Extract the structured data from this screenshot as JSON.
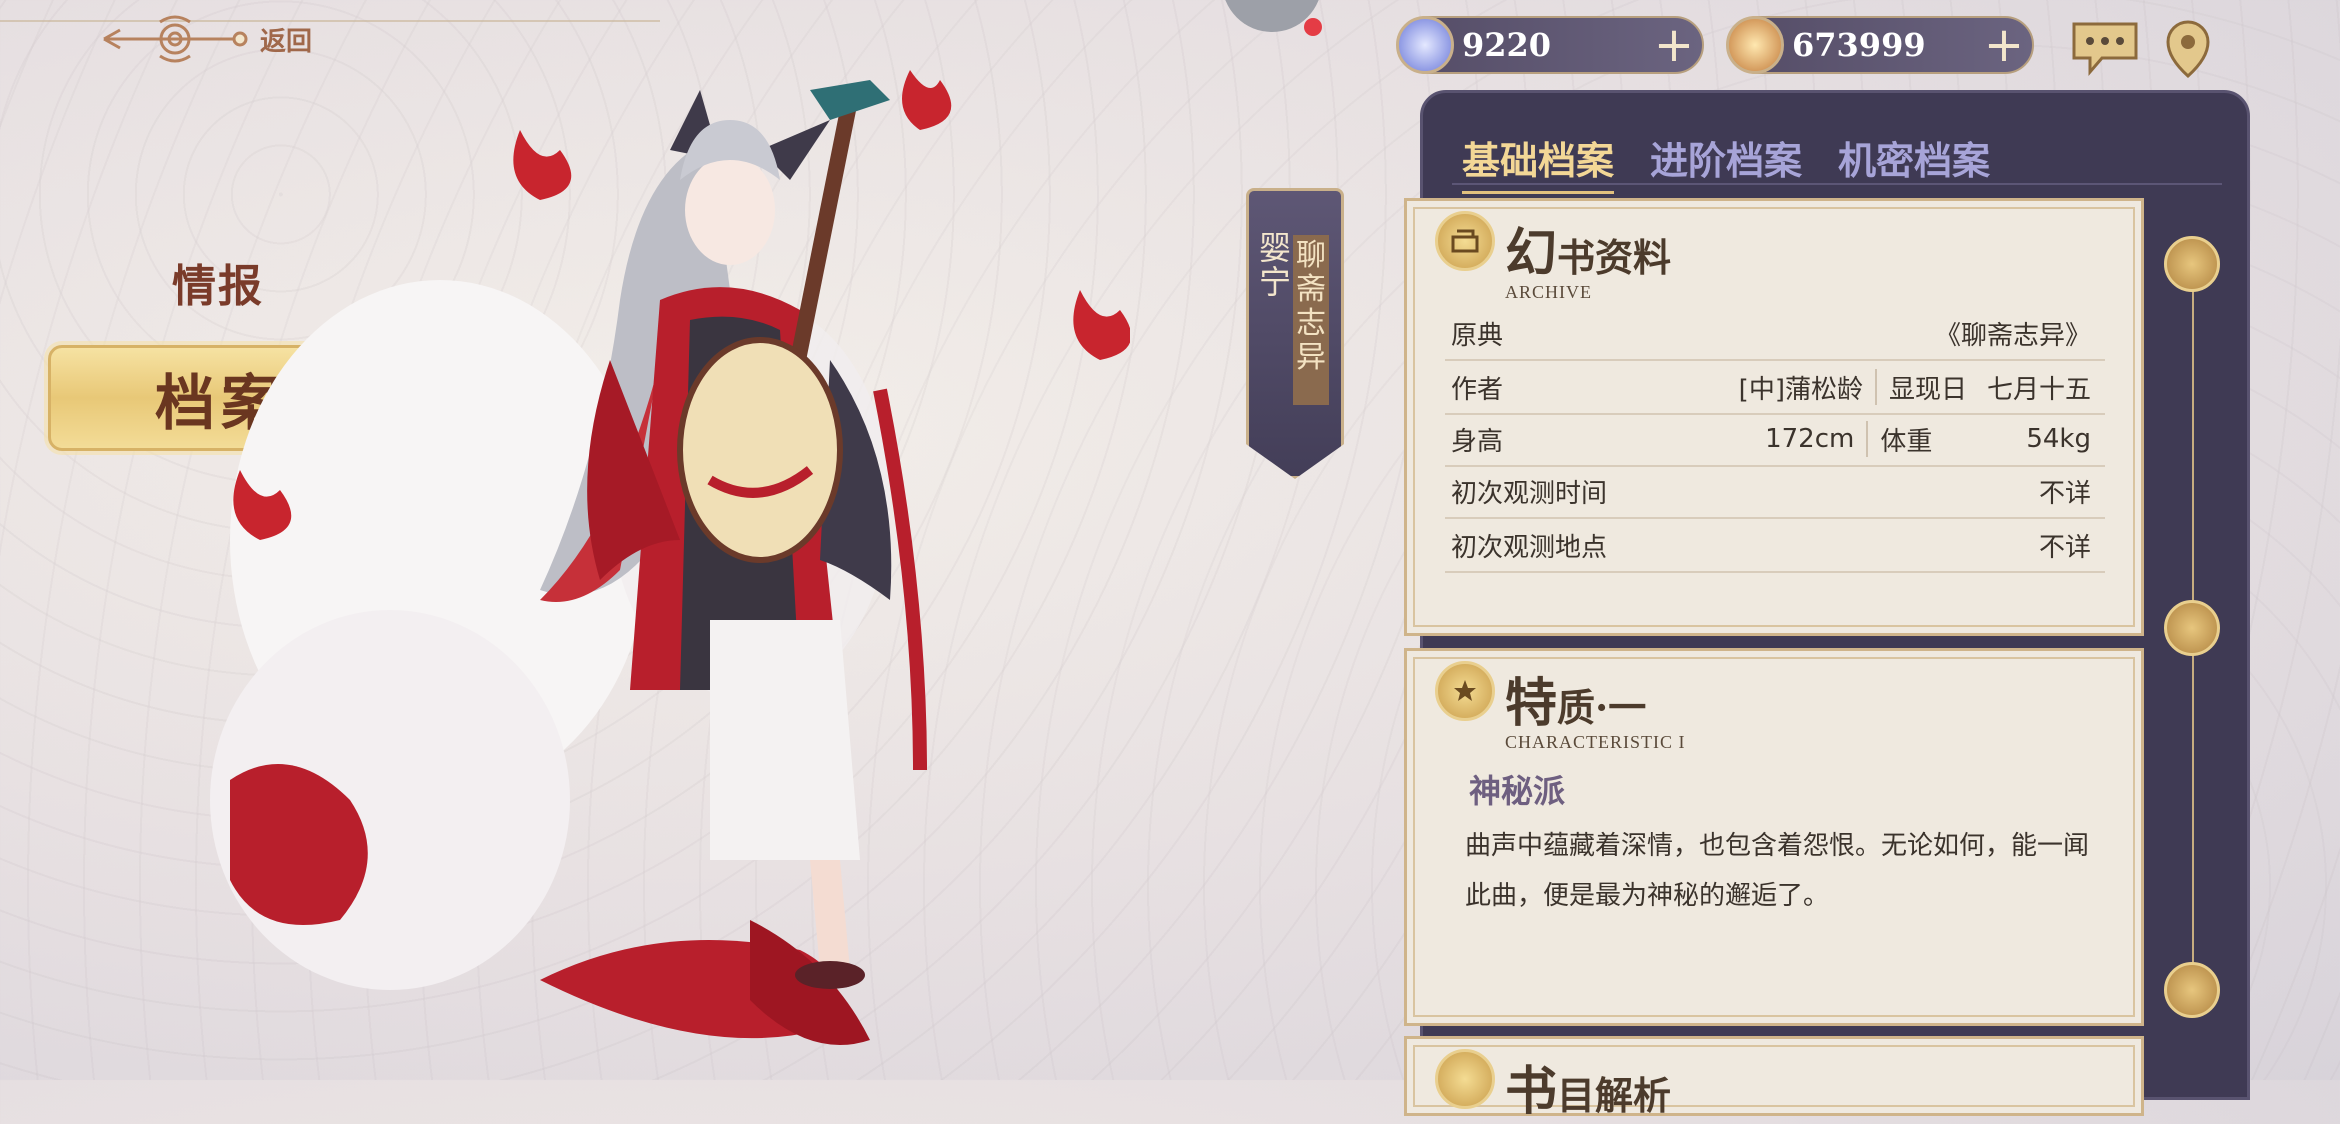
{
  "header": {
    "back_label": "返回"
  },
  "currencies": [
    {
      "name": "crystal",
      "value": "9220",
      "plus": "+"
    },
    {
      "name": "coin",
      "value": "673999",
      "plus": "+"
    }
  ],
  "left_menu": {
    "intel_label": "情报",
    "archive_label": "档案"
  },
  "character": {
    "name": "婴宁",
    "source": "聊斋志异"
  },
  "tabs": [
    {
      "label": "基础档案",
      "active": true
    },
    {
      "label": "进阶档案",
      "active": false
    },
    {
      "label": "机密档案",
      "active": false
    }
  ],
  "archive_card": {
    "title_big": "幻",
    "title_rest": "书资料",
    "subtitle": "ARCHIVE",
    "rows": {
      "origin": {
        "key": "原典",
        "value": "《聊斋志异》"
      },
      "author": {
        "key": "作者",
        "value": "[中]蒲松龄",
        "key2": "显现日",
        "value2": "七月十五"
      },
      "height": {
        "key": "身高",
        "value": "172cm",
        "key2": "体重",
        "value2": "54kg"
      },
      "first_time": {
        "key": "初次观测时间",
        "value": "不详"
      },
      "first_place": {
        "key": "初次观测地点",
        "value": "不详"
      }
    }
  },
  "trait_card": {
    "title_big": "特",
    "title_rest": "质·一",
    "subtitle": "CHARACTERISTIC I",
    "name": "神秘派",
    "desc": "曲声中蕴藏着深情，也包含着怨恨。无论如何，能一闻此曲，便是最为神秘的邂逅了。"
  },
  "third_card": {
    "title_big": "书",
    "title_rest": "目解析"
  },
  "colors": {
    "panel": "#3f3a54",
    "tab_active": "#f3d796",
    "tab_inactive": "#a7a4d8",
    "card": "#efe9df",
    "accent_red": "#b3202c"
  }
}
